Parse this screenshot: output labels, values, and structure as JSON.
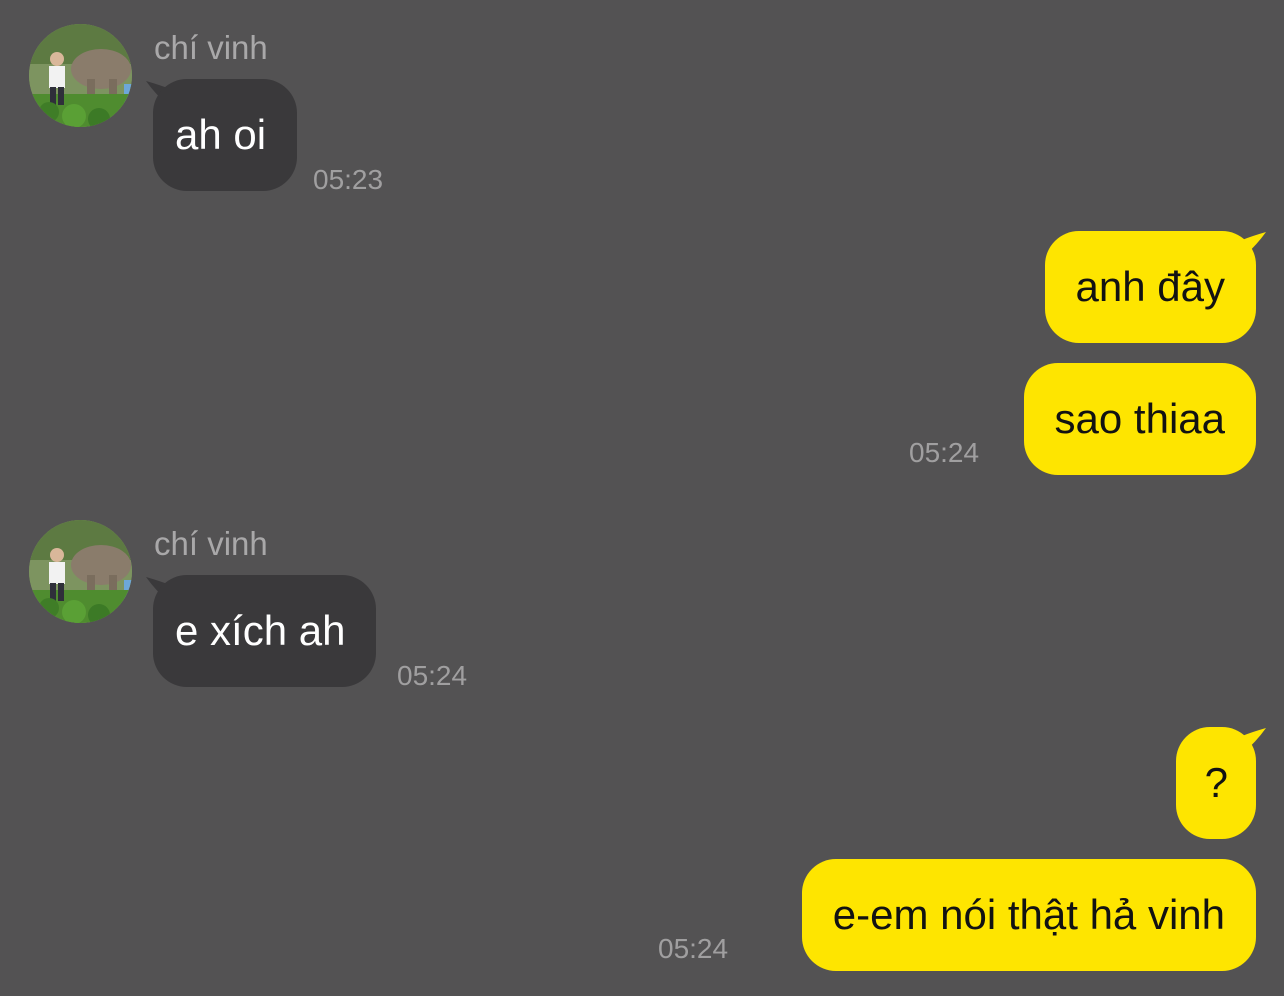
{
  "colors": {
    "background": "#535253",
    "incoming_bubble": "#3a393b",
    "outgoing_bubble": "#fee500",
    "timestamp": "#a09fa0",
    "sender_name": "#a9a8a9"
  },
  "messages": [
    {
      "sender": "chí vinh",
      "avatar_icon": "user-avatar-icon",
      "text": "ah oi",
      "time": "05:23"
    },
    {
      "text": "anh đây"
    },
    {
      "text": "sao thiaa",
      "time": "05:24"
    },
    {
      "sender": "chí vinh",
      "avatar_icon": "user-avatar-icon",
      "text": "e xích ah",
      "time": "05:24"
    },
    {
      "text": "?"
    },
    {
      "text": "e-em nói thật hả vinh",
      "time": "05:24"
    }
  ]
}
